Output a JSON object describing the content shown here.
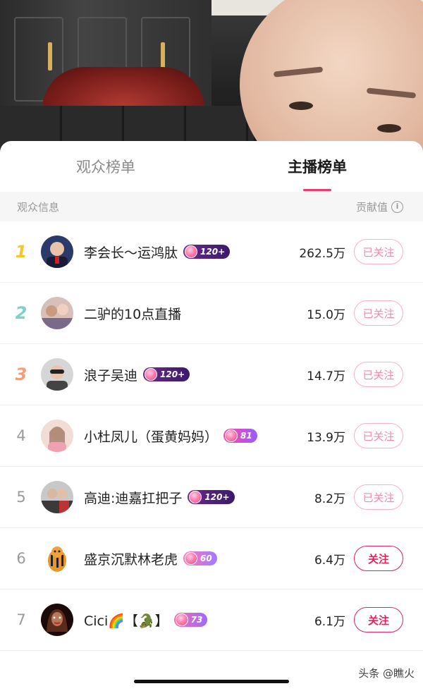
{
  "tabs": [
    {
      "label": "观众榜单",
      "active": false
    },
    {
      "label": "主播榜单",
      "active": true
    }
  ],
  "header": {
    "left": "观众信息",
    "right": "贡献值",
    "info_icon": "i"
  },
  "rows": [
    {
      "rank": "1",
      "name": "李会长～运鸿肽",
      "badge": "120+",
      "value": "262.5万",
      "follow": "已关注"
    },
    {
      "rank": "2",
      "name": "二驴的10点直播",
      "badge": "",
      "value": "15.0万",
      "follow": "已关注"
    },
    {
      "rank": "3",
      "name": "浪子吴迪",
      "badge": "120+",
      "value": "14.7万",
      "follow": "已关注"
    },
    {
      "rank": "4",
      "name": "小杜凤儿（蛋黄妈妈）",
      "badge": "81",
      "value": "13.9万",
      "follow": "已关注"
    },
    {
      "rank": "5",
      "name": "高迪:迪嘉扛把子",
      "badge": "120+",
      "value": "8.2万",
      "follow": "已关注"
    },
    {
      "rank": "6",
      "name": "盛京沉默林老虎",
      "badge": "60",
      "value": "6.4万",
      "follow": "关注"
    },
    {
      "rank": "7",
      "name": "Cici🌈【🐊】",
      "badge": "73",
      "value": "6.1万",
      "follow": "关注"
    }
  ],
  "colors": {
    "accent": "#f03a6e",
    "follow_red": "#e0245e",
    "followed_pink": "#f08aa9"
  },
  "watermark": "头条 @瞧火"
}
